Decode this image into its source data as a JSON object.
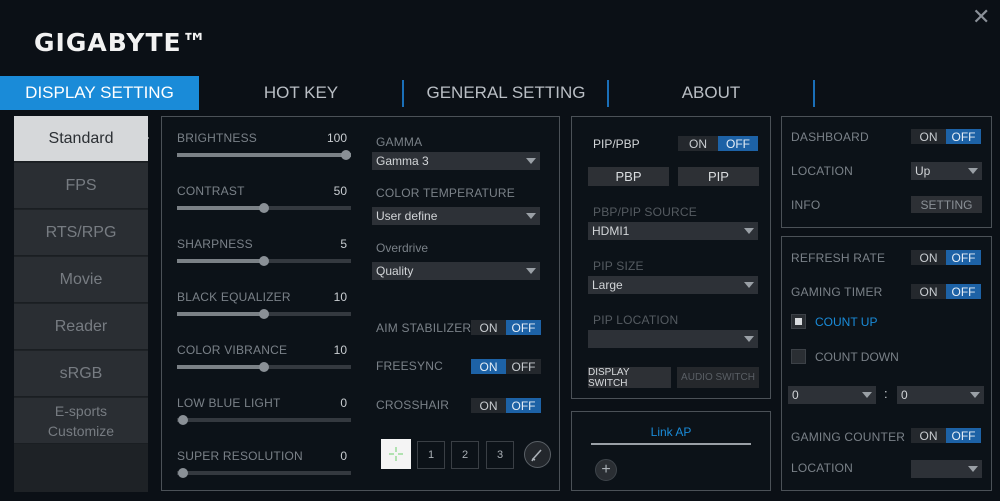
{
  "brand": {
    "logo": "GIGABYTE™",
    "close_icon": "✕"
  },
  "tabs": [
    {
      "label": "DISPLAY SETTING",
      "active": true
    },
    {
      "label": "HOT KEY"
    },
    {
      "label": "GENERAL SETTING"
    },
    {
      "label": "ABOUT"
    }
  ],
  "modes": [
    "Standard",
    "FPS",
    "RTS/RPG",
    "Movie",
    "Reader",
    "sRGB",
    "E-sports\nCustomize"
  ],
  "sliders": [
    {
      "label": "BRIGHTNESS",
      "value": "100",
      "level": 100
    },
    {
      "label": "CONTRAST",
      "value": "50",
      "level": 50
    },
    {
      "label": "SHARPNESS",
      "value": "5",
      "level": 50
    },
    {
      "label": "BLACK EQUALIZER",
      "value": "10",
      "level": 50
    },
    {
      "label": "COLOR VIBRANCE",
      "value": "10",
      "level": 50
    },
    {
      "label": "LOW BLUE LIGHT",
      "value": "0",
      "level": 0
    },
    {
      "label": "SUPER RESOLUTION",
      "value": "0",
      "level": 0
    }
  ],
  "picture": {
    "gamma_label": "GAMMA",
    "gamma_value": "Gamma 3",
    "color_temp_label": "COLOR TEMPERATURE",
    "color_temp_value": "User define",
    "overdrive_label": "Overdrive",
    "overdrive_value": "Quality",
    "aim_label": "AIM STABILIZER",
    "aim_state": "OFF",
    "freesync_label": "FREESYNC",
    "freesync_state": "ON",
    "crosshair_label": "CROSSHAIR",
    "crosshair_state": "OFF",
    "crosshair_options": [
      "1",
      "2",
      "3"
    ],
    "crosshair_icon": "crosshair-icon",
    "pencil_icon": "pencil-icon"
  },
  "toggle_text": {
    "on": "ON",
    "off": "OFF"
  },
  "pip": {
    "title": "PIP/PBP",
    "state": "OFF",
    "pbp_button": "PBP",
    "pip_button": "PIP",
    "source_label": "PBP/PIP SOURCE",
    "source_value": "HDMI1",
    "size_label": "PIP SIZE",
    "size_value": "Large",
    "location_label": "PIP LOCATION",
    "location_value": "",
    "display_switch": "DISPLAY SWITCH",
    "audio_switch": "AUDIO SWITCH"
  },
  "link": {
    "label": "Link AP",
    "add_icon": "plus-icon"
  },
  "dashboard": {
    "label": "DASHBOARD",
    "state": "OFF",
    "location_label": "LOCATION",
    "location_value": "Up",
    "info_label": "INFO",
    "setting_button": "SETTING"
  },
  "gaming": {
    "refresh_label": "REFRESH RATE",
    "refresh_state": "OFF",
    "timer_label": "GAMING TIMER",
    "timer_state": "OFF",
    "count_up": "COUNT UP",
    "count_down": "COUNT DOWN",
    "minutes_value": "0",
    "seconds_value": "0",
    "separator": ":",
    "counter_label": "GAMING COUNTER",
    "counter_state": "OFF",
    "location_label": "LOCATION",
    "location_value": ""
  },
  "colors": {
    "accent": "#1a8bd8",
    "toggle_active": "#1d62a6",
    "panel_border": "#4b5157",
    "background": "#0b1016"
  }
}
